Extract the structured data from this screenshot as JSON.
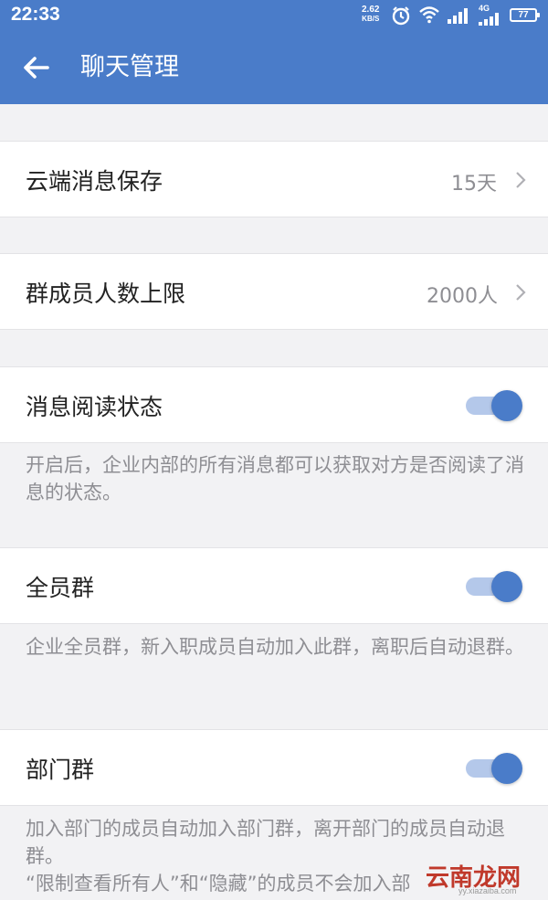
{
  "status_bar": {
    "time": "22:33",
    "speed_value": "2.62",
    "speed_unit": "KB/S",
    "network_type": "4G",
    "battery_level": "77",
    "icons": [
      "alarm-icon",
      "wifi-icon",
      "signal-icon",
      "signal-icon",
      "battery-icon"
    ]
  },
  "app_bar": {
    "title": "聊天管理",
    "back_icon": "arrow-left-icon",
    "color": "#4a7cc9"
  },
  "settings": {
    "cloud_storage": {
      "label": "云端消息保存",
      "value": "15天"
    },
    "member_limit": {
      "label": "群成员人数上限",
      "value": "2000人"
    },
    "read_status": {
      "label": "消息阅读状态",
      "enabled": true,
      "description": "开启后，企业内部的所有消息都可以获取对方是否阅读了消息的状态。"
    },
    "all_staff_group": {
      "label": "全员群",
      "enabled": true,
      "description": "企业全员群，新入职成员自动加入此群，离职后自动退群。"
    },
    "department_group": {
      "label": "部门群",
      "enabled": true,
      "description_line1": "加入部门的成员自动加入部门群，离开部门的成员自动退群。",
      "description_line2": "“限制查看所有人”和“隐藏”的成员不会加入部"
    }
  },
  "watermark": {
    "text": "云南龙网",
    "sub": "yy.xiazaiba.com"
  },
  "colors": {
    "accent": "#4a7cc9",
    "toggle_track": "#b4c8ea",
    "background": "#f2f2f4"
  }
}
